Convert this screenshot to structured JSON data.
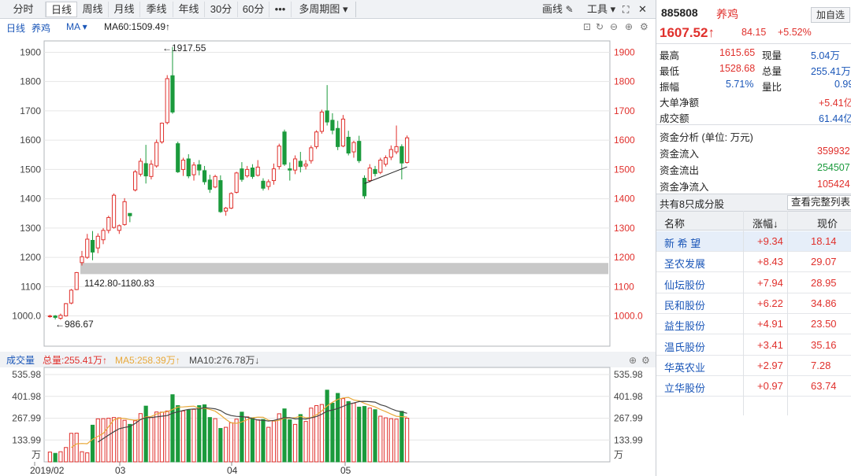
{
  "toolbar": {
    "tabs": [
      "分时",
      "日线",
      "周线",
      "月线",
      "季线",
      "年线",
      "30分",
      "60分",
      "•••",
      "多周期图 ▾"
    ],
    "active_tab": "日线",
    "draw_label": "画线",
    "tools_label": "工具 ▾"
  },
  "info": {
    "period": "日线",
    "name": "养鸡",
    "ma_label": "MA ▾",
    "ma60": "MA60:1509.49↑"
  },
  "volume_info": {
    "label": "成交量",
    "total": "总量:255.41万↑",
    "ma5": "MA5:258.39万↑",
    "ma10": "MA10:276.78万↓"
  },
  "annotations": {
    "high": "←1917.55",
    "low": "←986.67",
    "gap": "1142.80-1180.83"
  },
  "x_labels": [
    "2019/02",
    "03",
    "04",
    "05"
  ],
  "price_ticks": [
    "1900",
    "1800",
    "1700",
    "1600",
    "1500",
    "1400",
    "1300",
    "1200",
    "1100",
    "1000.0"
  ],
  "volume_ticks": [
    "535.98",
    "401.98",
    "267.99",
    "133.99",
    "万"
  ],
  "colors": {
    "up": "#e0302c",
    "down": "#1b9a3c",
    "ma60": "#222222",
    "ma5": "#e8a93a",
    "ma10": "#444444",
    "gap": "#c8c8c8"
  },
  "chart_data": {
    "type": "candlestick",
    "price_axis": [
      1000,
      1900
    ],
    "volume_axis": [
      0,
      535.98
    ],
    "candles": [
      {
        "o": 1000,
        "h": 1004,
        "l": 994,
        "c": 1000,
        "v": 60
      },
      {
        "o": 1000,
        "h": 1003,
        "l": 988,
        "c": 995,
        "v": 52
      },
      {
        "o": 992,
        "h": 1008,
        "l": 987,
        "c": 1002,
        "v": 62
      },
      {
        "o": 1000,
        "h": 1044,
        "l": 998,
        "c": 1042,
        "v": 88
      },
      {
        "o": 1044,
        "h": 1092,
        "l": 1040,
        "c": 1088,
        "v": 175
      },
      {
        "o": 1090,
        "h": 1150,
        "l": 1088,
        "c": 1148,
        "v": 176
      },
      {
        "o": 1182,
        "h": 1222,
        "l": 1172,
        "c": 1202,
        "v": 62
      },
      {
        "o": 1200,
        "h": 1280,
        "l": 1195,
        "c": 1262,
        "v": 55
      },
      {
        "o": 1258,
        "h": 1290,
        "l": 1190,
        "c": 1218,
        "v": 225
      },
      {
        "o": 1232,
        "h": 1282,
        "l": 1214,
        "c": 1272,
        "v": 264
      },
      {
        "o": 1260,
        "h": 1300,
        "l": 1245,
        "c": 1292,
        "v": 265
      },
      {
        "o": 1292,
        "h": 1342,
        "l": 1282,
        "c": 1336,
        "v": 268
      },
      {
        "o": 1302,
        "h": 1418,
        "l": 1298,
        "c": 1412,
        "v": 272
      },
      {
        "o": 1292,
        "h": 1312,
        "l": 1280,
        "c": 1308,
        "v": 270
      },
      {
        "o": 1312,
        "h": 1402,
        "l": 1308,
        "c": 1390,
        "v": 255
      },
      {
        "o": 1350,
        "h": 1322,
        "l": 1320,
        "c": 1342,
        "v": 230
      },
      {
        "o": 1430,
        "h": 1498,
        "l": 1425,
        "c": 1492,
        "v": 252
      },
      {
        "o": 1484,
        "h": 1538,
        "l": 1476,
        "c": 1528,
        "v": 296
      },
      {
        "o": 1520,
        "h": 1584,
        "l": 1452,
        "c": 1478,
        "v": 342
      },
      {
        "o": 1476,
        "h": 1532,
        "l": 1466,
        "c": 1518,
        "v": 272
      },
      {
        "o": 1512,
        "h": 1602,
        "l": 1506,
        "c": 1592,
        "v": 306
      },
      {
        "o": 1594,
        "h": 1660,
        "l": 1588,
        "c": 1658,
        "v": 305
      },
      {
        "o": 1660,
        "h": 1822,
        "l": 1654,
        "c": 1810,
        "v": 312
      },
      {
        "o": 1820,
        "h": 1918,
        "l": 1690,
        "c": 1696,
        "v": 412
      },
      {
        "o": 1588,
        "h": 1595,
        "l": 1488,
        "c": 1492,
        "v": 345
      },
      {
        "o": 1500,
        "h": 1540,
        "l": 1478,
        "c": 1532,
        "v": 312
      },
      {
        "o": 1536,
        "h": 1552,
        "l": 1470,
        "c": 1478,
        "v": 318
      },
      {
        "o": 1482,
        "h": 1525,
        "l": 1462,
        "c": 1515,
        "v": 322
      },
      {
        "o": 1516,
        "h": 1532,
        "l": 1480,
        "c": 1498,
        "v": 345
      },
      {
        "o": 1496,
        "h": 1512,
        "l": 1448,
        "c": 1458,
        "v": 350
      },
      {
        "o": 1464,
        "h": 1482,
        "l": 1420,
        "c": 1432,
        "v": 272
      },
      {
        "o": 1440,
        "h": 1482,
        "l": 1436,
        "c": 1476,
        "v": 265
      },
      {
        "o": 1462,
        "h": 1480,
        "l": 1352,
        "c": 1356,
        "v": 205
      },
      {
        "o": 1358,
        "h": 1372,
        "l": 1342,
        "c": 1368,
        "v": 212
      },
      {
        "o": 1368,
        "h": 1422,
        "l": 1365,
        "c": 1418,
        "v": 240
      },
      {
        "o": 1422,
        "h": 1492,
        "l": 1418,
        "c": 1488,
        "v": 262
      },
      {
        "o": 1502,
        "h": 1525,
        "l": 1458,
        "c": 1466,
        "v": 305
      },
      {
        "o": 1478,
        "h": 1512,
        "l": 1472,
        "c": 1500,
        "v": 276
      },
      {
        "o": 1505,
        "h": 1518,
        "l": 1468,
        "c": 1476,
        "v": 270
      },
      {
        "o": 1480,
        "h": 1532,
        "l": 1476,
        "c": 1508,
        "v": 258
      },
      {
        "o": 1460,
        "h": 1470,
        "l": 1428,
        "c": 1436,
        "v": 260
      },
      {
        "o": 1442,
        "h": 1466,
        "l": 1430,
        "c": 1458,
        "v": 212
      },
      {
        "o": 1462,
        "h": 1520,
        "l": 1448,
        "c": 1502,
        "v": 250
      },
      {
        "o": 1510,
        "h": 1588,
        "l": 1500,
        "c": 1580,
        "v": 295
      },
      {
        "o": 1628,
        "h": 1636,
        "l": 1512,
        "c": 1518,
        "v": 325
      },
      {
        "o": 1502,
        "h": 1524,
        "l": 1462,
        "c": 1498,
        "v": 258
      },
      {
        "o": 1498,
        "h": 1548,
        "l": 1484,
        "c": 1536,
        "v": 230
      },
      {
        "o": 1528,
        "h": 1560,
        "l": 1490,
        "c": 1510,
        "v": 290
      },
      {
        "o": 1512,
        "h": 1532,
        "l": 1500,
        "c": 1518,
        "v": 248
      },
      {
        "o": 1530,
        "h": 1582,
        "l": 1520,
        "c": 1574,
        "v": 330
      },
      {
        "o": 1578,
        "h": 1634,
        "l": 1570,
        "c": 1628,
        "v": 345
      },
      {
        "o": 1630,
        "h": 1704,
        "l": 1622,
        "c": 1696,
        "v": 352
      },
      {
        "o": 1700,
        "h": 1788,
        "l": 1650,
        "c": 1662,
        "v": 440
      },
      {
        "o": 1668,
        "h": 1692,
        "l": 1620,
        "c": 1634,
        "v": 360
      },
      {
        "o": 1640,
        "h": 1666,
        "l": 1566,
        "c": 1578,
        "v": 420
      },
      {
        "o": 1580,
        "h": 1686,
        "l": 1576,
        "c": 1672,
        "v": 388
      },
      {
        "o": 1610,
        "h": 1632,
        "l": 1548,
        "c": 1556,
        "v": 370
      },
      {
        "o": 1560,
        "h": 1598,
        "l": 1540,
        "c": 1592,
        "v": 360
      },
      {
        "o": 1596,
        "h": 1615,
        "l": 1522,
        "c": 1530,
        "v": 336
      },
      {
        "o": 1470,
        "h": 1480,
        "l": 1400,
        "c": 1410,
        "v": 340
      },
      {
        "o": 1462,
        "h": 1518,
        "l": 1456,
        "c": 1505,
        "v": 330
      },
      {
        "o": 1500,
        "h": 1512,
        "l": 1476,
        "c": 1486,
        "v": 320
      },
      {
        "o": 1490,
        "h": 1540,
        "l": 1484,
        "c": 1532,
        "v": 280
      },
      {
        "o": 1518,
        "h": 1548,
        "l": 1510,
        "c": 1540,
        "v": 270
      },
      {
        "o": 1542,
        "h": 1582,
        "l": 1532,
        "c": 1568,
        "v": 265
      },
      {
        "o": 1560,
        "h": 1650,
        "l": 1552,
        "c": 1578,
        "v": 262
      },
      {
        "o": 1578,
        "h": 1586,
        "l": 1466,
        "c": 1522,
        "v": 310
      },
      {
        "o": 1524,
        "h": 1616,
        "l": 1520,
        "c": 1608,
        "v": 268
      }
    ],
    "ma60_line": [
      [
        1460,
        1452
      ],
      [
        1515,
        1509
      ]
    ],
    "gap_band": [
      1142.8,
      1180.83
    ]
  },
  "quote": {
    "code": "885808",
    "name": "养鸡",
    "add_label": "加自选",
    "price": "1607.52↑",
    "change": "84.15",
    "pct": "+5.52%",
    "stats": [
      {
        "k1": "最高",
        "v1": "1615.65",
        "k2": "现量",
        "v2": "5.04万"
      },
      {
        "k1": "最低",
        "v1": "1528.68",
        "k2": "总量",
        "v2": "255.41万"
      },
      {
        "k1": "振幅",
        "v1": "5.71%",
        "k2": "量比",
        "v2": "0.99"
      }
    ],
    "big_net_label": "大单净额",
    "big_net": "+5.41亿",
    "turnover_label": "成交额",
    "turnover": "61.44亿",
    "fund_title": "资金分析 (单位: 万元)",
    "fund_in_label": "资金流入",
    "fund_in": "359932",
    "fund_out_label": "资金流出",
    "fund_out": "254507",
    "fund_net_label": "资金净流入",
    "fund_net": "105424",
    "constituents_label": "共有8只成分股",
    "full_list_label": "查看完整列表",
    "table_headers": [
      "名称",
      "涨幅↓",
      "现价"
    ],
    "rows": [
      {
        "name": "新 希 望",
        "pct": "+9.34",
        "price": "18.14"
      },
      {
        "name": "圣农发展",
        "pct": "+8.43",
        "price": "29.07"
      },
      {
        "name": "仙坛股份",
        "pct": "+7.94",
        "price": "28.95"
      },
      {
        "name": "民和股份",
        "pct": "+6.22",
        "price": "34.86"
      },
      {
        "name": "益生股份",
        "pct": "+4.91",
        "price": "23.50"
      },
      {
        "name": "温氏股份",
        "pct": "+3.41",
        "price": "35.16"
      },
      {
        "name": "华英农业",
        "pct": "+2.97",
        "price": "7.28"
      },
      {
        "name": "立华股份",
        "pct": "+0.97",
        "price": "63.74"
      }
    ]
  }
}
